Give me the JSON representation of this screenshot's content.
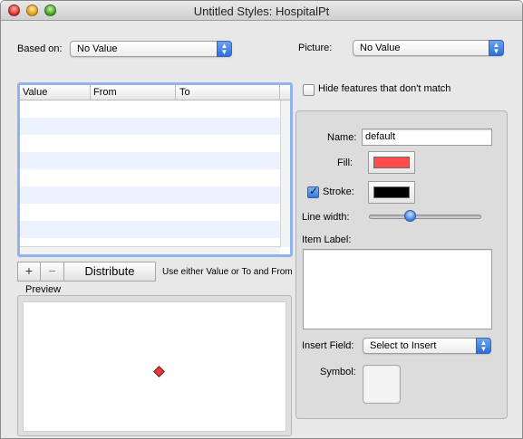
{
  "window": {
    "title": "Untitled Styles: HospitalPt"
  },
  "based_on": {
    "label": "Based on:",
    "value": "No Value"
  },
  "picture": {
    "label": "Picture:",
    "value": "No Value"
  },
  "table": {
    "columns": [
      "Value",
      "From",
      "To"
    ],
    "row_count": 8
  },
  "toolbar": {
    "add_label": "+",
    "remove_label": "−",
    "distribute_label": "Distribute",
    "hint": "Use either Value or To and From"
  },
  "preview": {
    "label": "Preview",
    "marker_color": "#e23b3b"
  },
  "hide_features": {
    "label": "Hide features that don't match",
    "checked": false
  },
  "style": {
    "name_label": "Name:",
    "name_value": "default",
    "fill_label": "Fill:",
    "fill_color": "#ff4b4b",
    "stroke_label": "Stroke:",
    "stroke_checked": true,
    "stroke_color": "#000000",
    "line_width_label": "Line width:",
    "line_width_fraction": 0.35,
    "item_label_label": "Item Label:",
    "item_label_value": "",
    "insert_field_label": "Insert Field:",
    "insert_field_value": "Select to Insert",
    "symbol_label": "Symbol:"
  },
  "icons": {
    "close": "close-icon",
    "minimize": "minimize-icon",
    "zoom": "zoom-icon",
    "popup_arrows": "updown-arrows-icon",
    "checkmark": "checkmark-icon"
  }
}
